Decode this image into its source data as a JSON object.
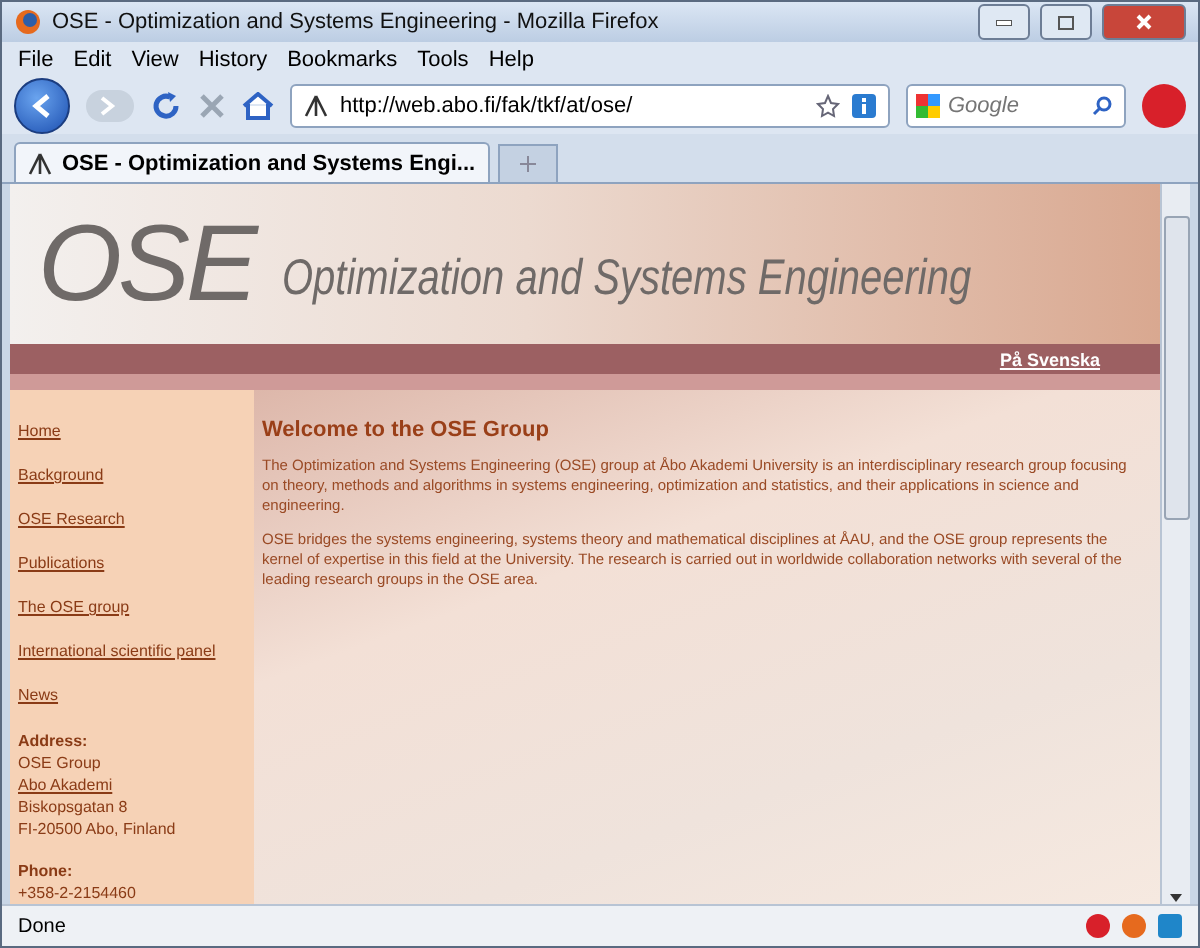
{
  "window": {
    "title": "OSE - Optimization and Systems Engineering - Mozilla Firefox"
  },
  "menu": [
    "File",
    "Edit",
    "View",
    "History",
    "Bookmarks",
    "Tools",
    "Help"
  ],
  "address": {
    "value": "http://web.abo.fi/fak/tkf/at/ose/"
  },
  "search": {
    "placeholder": "Google"
  },
  "tabs": [
    {
      "label": "OSE - Optimization and Systems Engi...",
      "selected": true
    }
  ],
  "page": {
    "logo": "OSE",
    "subtitle": "Optimization and Systems Engineering",
    "language_link": "På Svenska",
    "nav": [
      "Home",
      "Background",
      "OSE Research",
      "Publications",
      "The OSE group",
      "International scientific panel",
      "News"
    ],
    "address_label": "Address:",
    "address_lines": [
      {
        "text": "OSE Group",
        "kind": "text"
      },
      {
        "text": "Abo Akademi",
        "kind": "link"
      },
      {
        "text": "Biskopsgatan 8",
        "kind": "text"
      },
      {
        "text": "FI-20500 Abo, Finland",
        "kind": "text"
      }
    ],
    "phone_label": "Phone:",
    "phone": "+358-2-2154460",
    "heading": "Welcome to the OSE Group",
    "paragraphs": [
      "The Optimization and Systems Engineering (OSE) group at Åbo Akademi University is an interdisciplinary research group focusing on theory, methods and algorithms in systems engineering, optimization and statistics, and their applications in science and engineering.",
      "OSE bridges the systems engineering, systems theory and mathematical disciplines at ÅAU, and the OSE group represents the kernel of expertise in this field at the University. The research is carried out in worldwide collaboration networks with several of the leading research groups in the OSE area."
    ]
  },
  "status_bar": {
    "text": "Done"
  }
}
